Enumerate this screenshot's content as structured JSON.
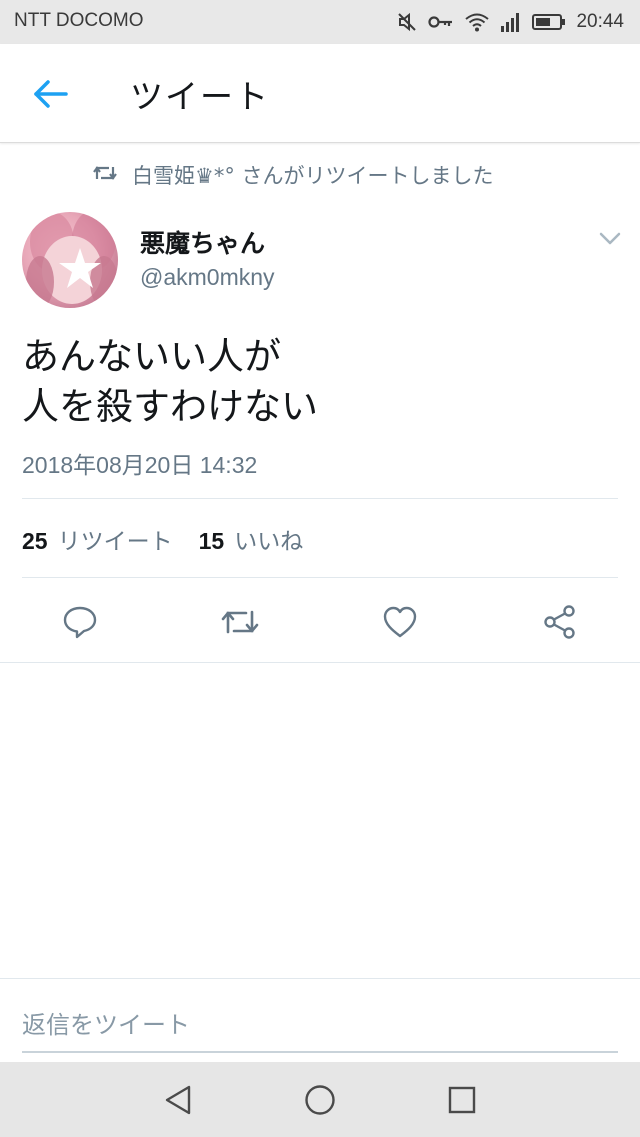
{
  "status_bar": {
    "carrier": "NTT DOCOMO",
    "time": "20:44",
    "icons": [
      "mute-icon",
      "key-icon",
      "wifi-icon",
      "signal-icon",
      "battery-icon"
    ]
  },
  "app_bar": {
    "title": "ツイート",
    "back_icon": "arrow-left-icon",
    "accent_color": "#1da1f2"
  },
  "retweet_context": {
    "text": "白雪姫♛*° さんがリツイートしました",
    "icon": "retweet-icon"
  },
  "tweet": {
    "author": {
      "display_name": "悪魔ちゃん",
      "handle": "@akm0mkny"
    },
    "text_lines": [
      "あんないい人が",
      "人を殺すわけない"
    ],
    "timestamp": "2018年08月20日 14:32"
  },
  "stats": {
    "retweets": {
      "count": "25",
      "label": "リツイート"
    },
    "likes": {
      "count": "15",
      "label": "いいね"
    }
  },
  "actions": [
    "reply-icon",
    "retweet-icon",
    "like-icon",
    "share-icon"
  ],
  "reply": {
    "placeholder": "返信をツイート"
  },
  "nav": [
    "back-triangle-icon",
    "home-circle-icon",
    "recents-square-icon"
  ]
}
